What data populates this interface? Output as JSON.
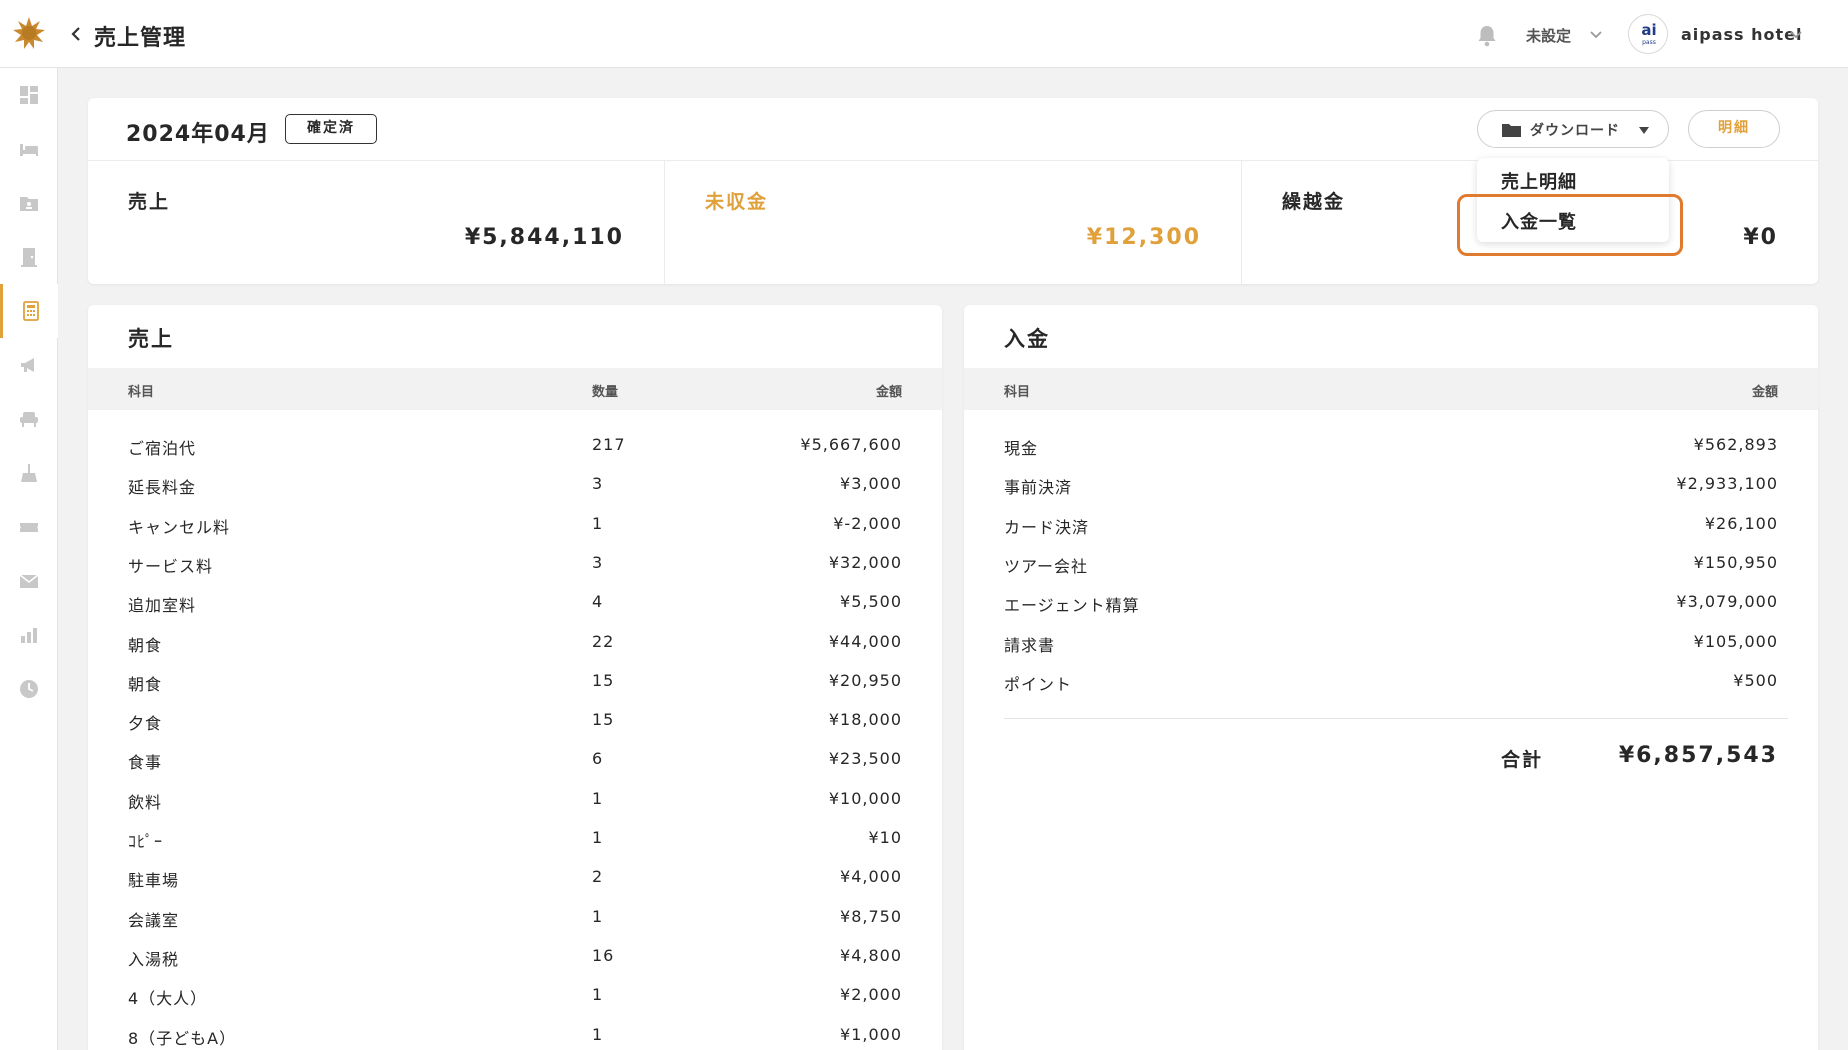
{
  "header": {
    "title": "売上管理",
    "store_label": "未設定",
    "avatar_text": "ai",
    "avatar_sub": "pass",
    "hotel_name": "aipass hotel"
  },
  "sidebar": {
    "items": [
      {
        "icon": "dashboard-icon"
      },
      {
        "icon": "bed-icon"
      },
      {
        "icon": "guest-folder-icon"
      },
      {
        "icon": "door-icon"
      },
      {
        "icon": "calculator-icon",
        "active": true
      },
      {
        "icon": "megaphone-icon"
      },
      {
        "icon": "armchair-icon"
      },
      {
        "icon": "cleaning-icon"
      },
      {
        "icon": "ticket-icon"
      },
      {
        "icon": "mail-icon"
      },
      {
        "icon": "bar-chart-icon"
      },
      {
        "icon": "clock-icon"
      }
    ]
  },
  "summary": {
    "month": "2024年04月",
    "status_badge": "確定済",
    "download_label": "ダウンロード",
    "detail_label": "明細",
    "sales_label": "売上",
    "sales_value": "¥5,844,110",
    "receivable_label": "未収金",
    "receivable_value": "¥12,300",
    "carryover_label": "繰越金",
    "carryover_value": "¥0"
  },
  "dropdown": {
    "items": [
      "売上明細",
      "入金一覧"
    ]
  },
  "sales": {
    "title": "売上",
    "headers": {
      "item": "科目",
      "qty": "数量",
      "amount": "金額"
    },
    "rows": [
      {
        "item": "ご宿泊代",
        "qty": "217",
        "amount": "¥5,667,600"
      },
      {
        "item": "延長料金",
        "qty": "3",
        "amount": "¥3,000"
      },
      {
        "item": "キャンセル料",
        "qty": "1",
        "amount": "¥-2,000"
      },
      {
        "item": "サービス料",
        "qty": "3",
        "amount": "¥32,000"
      },
      {
        "item": "追加室料",
        "qty": "4",
        "amount": "¥5,500"
      },
      {
        "item": "朝食",
        "qty": "22",
        "amount": "¥44,000"
      },
      {
        "item": "朝食",
        "qty": "15",
        "amount": "¥20,950"
      },
      {
        "item": "夕食",
        "qty": "15",
        "amount": "¥18,000"
      },
      {
        "item": "食事",
        "qty": "6",
        "amount": "¥23,500"
      },
      {
        "item": "飲料",
        "qty": "1",
        "amount": "¥10,000"
      },
      {
        "item": "ｺﾋﾟｰ",
        "qty": "1",
        "amount": "¥10"
      },
      {
        "item": "駐車場",
        "qty": "2",
        "amount": "¥4,000"
      },
      {
        "item": "会議室",
        "qty": "1",
        "amount": "¥8,750"
      },
      {
        "item": "入湯税",
        "qty": "16",
        "amount": "¥4,800"
      },
      {
        "item": "4（大人）",
        "qty": "1",
        "amount": "¥2,000"
      },
      {
        "item": "8（子どもA）",
        "qty": "1",
        "amount": "¥1,000"
      }
    ]
  },
  "payments": {
    "title": "入金",
    "headers": {
      "item": "科目",
      "amount": "金額"
    },
    "rows": [
      {
        "item": "現金",
        "amount": "¥562,893"
      },
      {
        "item": "事前決済",
        "amount": "¥2,933,100"
      },
      {
        "item": "カード決済",
        "amount": "¥26,100"
      },
      {
        "item": "ツアー会社",
        "amount": "¥150,950"
      },
      {
        "item": "エージェント精算",
        "amount": "¥3,079,000"
      },
      {
        "item": "請求書",
        "amount": "¥105,000"
      },
      {
        "item": "ポイント",
        "amount": "¥500"
      }
    ],
    "total_label": "合計",
    "total_value": "¥6,857,543"
  },
  "colors": {
    "accent": "#e0a03a",
    "highlight": "#e07a2e"
  }
}
